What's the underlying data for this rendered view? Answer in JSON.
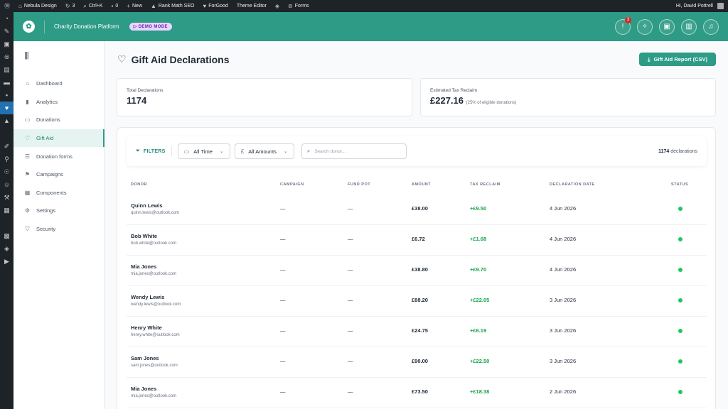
{
  "admin_bar": {
    "site_name": "Nebula Design",
    "updates_count": "3",
    "shortcut": "Ctrl+K",
    "comments_count": "0",
    "new_label": "New",
    "rankmath_label": "Rank Math SEO",
    "forgood_label": "ForGood",
    "theme_editor_label": "Theme Editor",
    "forms_label": "Forms",
    "greeting": "Hi, David Pottrell"
  },
  "app_header": {
    "title": "Charity Donation Platform",
    "demo_badge": "DEMO MODE",
    "notification_count": "3"
  },
  "sidebar": {
    "items": [
      {
        "label": "Dashboard",
        "icon": "home-icon"
      },
      {
        "label": "Analytics",
        "icon": "chart-icon"
      },
      {
        "label": "Donations",
        "icon": "card-icon"
      },
      {
        "label": "Gift Aid",
        "icon": "heart-icon",
        "active": true
      },
      {
        "label": "Donation forms",
        "icon": "list-icon"
      },
      {
        "label": "Campaigns",
        "icon": "flag-icon"
      },
      {
        "label": "Components",
        "icon": "grid-icon"
      },
      {
        "label": "Settings",
        "icon": "gear-icon"
      },
      {
        "label": "Security",
        "icon": "shield-icon"
      }
    ]
  },
  "page": {
    "title": "Gift Aid Declarations",
    "report_button": "Gift Aid Report (CSV)"
  },
  "stats": {
    "total_label": "Total Declarations",
    "total_value": "1174",
    "reclaim_label": "Estimated Tax Reclaim",
    "reclaim_value": "£227.16",
    "reclaim_note": "(25% of eligible donations)"
  },
  "filters": {
    "label": "FILTERS",
    "time_value": "All Time",
    "amount_value": "All Amounts",
    "search_placeholder": "Search donor...",
    "count_number": "1174",
    "count_suffix": "declarations"
  },
  "table": {
    "headers": {
      "donor": "DONOR",
      "campaign": "CAMPAIGN",
      "fund": "FUND POT",
      "amount": "AMOUNT",
      "tax": "TAX RECLAIM",
      "date": "DECLARATION DATE",
      "status": "STATUS"
    },
    "rows": [
      {
        "name": "Quinn Lewis",
        "email": "quinn.lewis@outlook.com",
        "campaign": "—",
        "fund": "—",
        "amount": "£38.00",
        "tax": "+£9.50",
        "date": "4 Jun 2026"
      },
      {
        "name": "Bob White",
        "email": "bob.white@outlook.com",
        "campaign": "—",
        "fund": "—",
        "amount": "£6.72",
        "tax": "+£1.68",
        "date": "4 Jun 2026"
      },
      {
        "name": "Mia Jones",
        "email": "mia.jones@outlook.com",
        "campaign": "—",
        "fund": "—",
        "amount": "£38.80",
        "tax": "+£9.70",
        "date": "4 Jun 2026"
      },
      {
        "name": "Wendy Lewis",
        "email": "wendy.lewis@outlook.com",
        "campaign": "—",
        "fund": "—",
        "amount": "£88.20",
        "tax": "+£22.05",
        "date": "3 Jun 2026"
      },
      {
        "name": "Henry White",
        "email": "henry.white@outlook.com",
        "campaign": "—",
        "fund": "—",
        "amount": "£24.75",
        "tax": "+£6.19",
        "date": "3 Jun 2026"
      },
      {
        "name": "Sam Jones",
        "email": "sam.jones@outlook.com",
        "campaign": "—",
        "fund": "—",
        "amount": "£90.00",
        "tax": "+£22.50",
        "date": "3 Jun 2026"
      },
      {
        "name": "Mia Jones",
        "email": "mia.jones@outlook.com",
        "campaign": "—",
        "fund": "—",
        "amount": "£73.50",
        "tax": "+£18.38",
        "date": "2 Jun 2026"
      }
    ]
  },
  "colors": {
    "brand": "#2d9b85",
    "status_active": "#22c55e",
    "tax_green": "#16a34a"
  }
}
